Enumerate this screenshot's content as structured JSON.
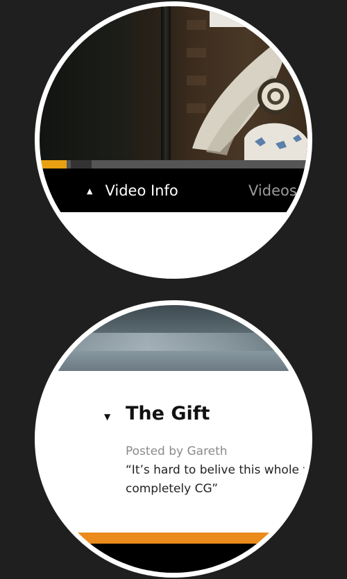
{
  "top_zoom": {
    "player": {
      "progress_fraction": 0.1,
      "progress_color": "#e9a012"
    },
    "tabs": [
      {
        "label": "Video Info",
        "indicator_icon": "triangle-up-icon",
        "indicator": "▲",
        "active": true
      },
      {
        "label": "Videos",
        "active": false
      }
    ]
  },
  "bottom_zoom": {
    "video": {
      "toggle_icon": "triangle-down-icon",
      "toggle": "▼",
      "title": "The Gift",
      "posted_by": "Posted by Gareth",
      "quote": "“It’s hard to belive this whole v is completely CG”"
    },
    "accent_color": "#ea8b1b"
  }
}
